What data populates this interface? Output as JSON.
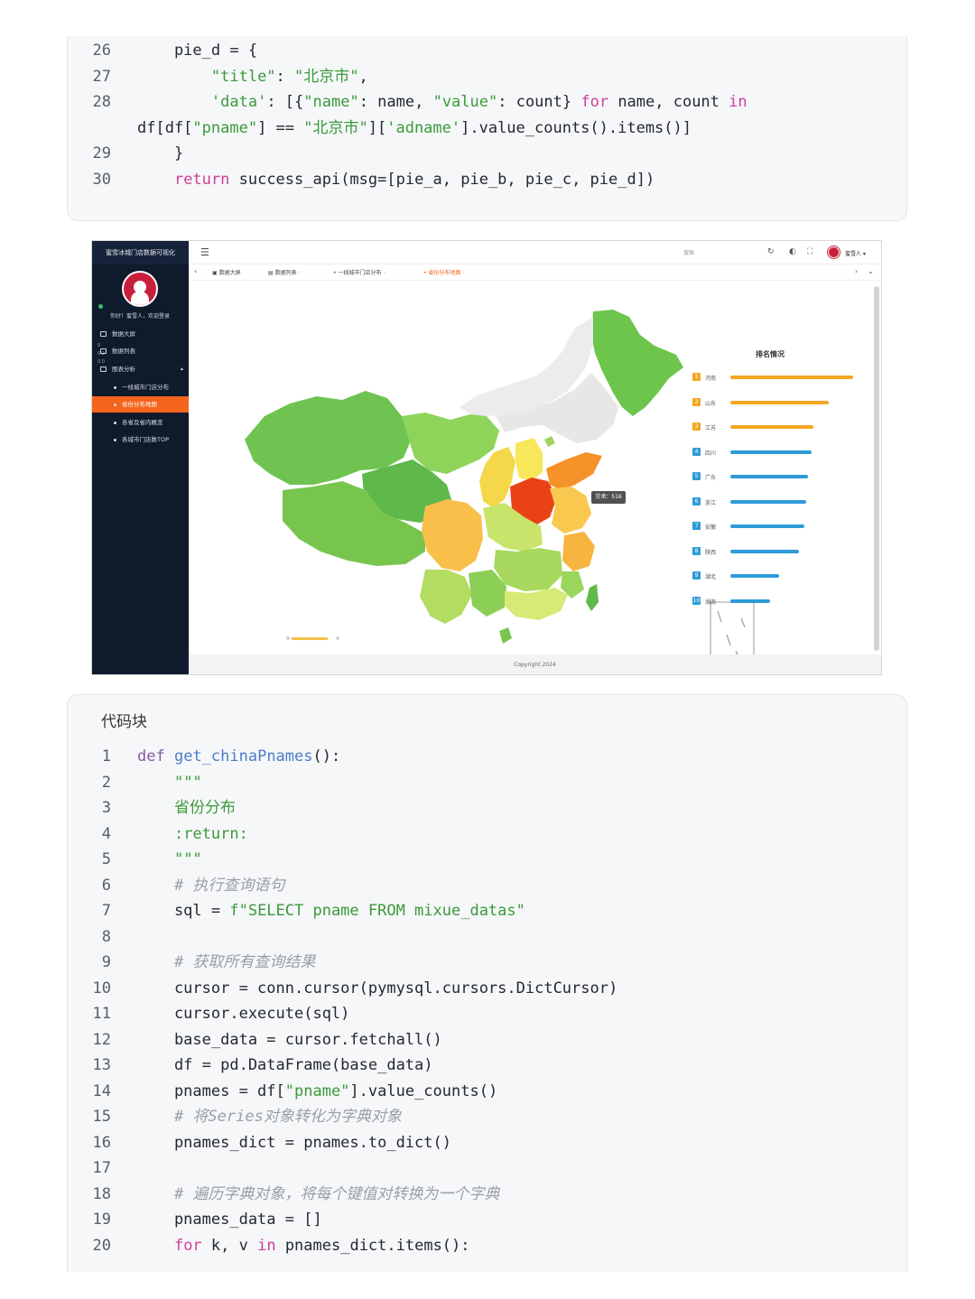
{
  "top_code": {
    "lines": [
      {
        "no": "26",
        "html": "    pie_d = {"
      },
      {
        "no": "27",
        "html": "        <span class=\"str\">\"title\"</span>: <span class=\"str\">\"北京市\"</span>,"
      },
      {
        "no": "28",
        "html": "        <span class=\"str\">'data'</span>: [{<span class=\"str\">\"name\"</span>: name, <span class=\"str\">\"value\"</span>: count} <span class=\"kw\">for</span> name, count <span class=\"kw\">in</span>"
      },
      {
        "no": "",
        "html": "df[df[<span class=\"str\">\"pname\"</span>] == <span class=\"str\">\"北京市\"</span>][<span class=\"str\">'adname'</span>].value_counts().items()]"
      },
      {
        "no": "29",
        "html": "    }"
      },
      {
        "no": "30",
        "html": "    <span class=\"kw\">return</span> success_api(msg=[pie_a, pie_b, pie_c, pie_d])"
      }
    ]
  },
  "dashboard": {
    "sidebar": {
      "app_title": "蜜雪冰城门店数据可视化",
      "greeting": "你好！蜜雪人，欢迎登录",
      "items": [
        {
          "label": "数据大屏"
        },
        {
          "label": "数据列表"
        },
        {
          "label": "图表分析"
        },
        {
          "label": "一线城市门店分布"
        },
        {
          "label": "省份分布地图"
        },
        {
          "label": "各省及省内概览"
        },
        {
          "label": "各城市门店数TOP"
        }
      ],
      "ticks": [
        "0",
        "0.2",
        "0.0"
      ]
    },
    "topbar": {
      "search_label": "搜索",
      "username": "蜜雪人 ▾"
    },
    "tabs": [
      {
        "label": "数据大屏"
      },
      {
        "label": "数据列表"
      },
      {
        "label": "一线城市门店分布"
      },
      {
        "label": "省份分布地图"
      }
    ],
    "map": {
      "tooltip": "甘肃：516",
      "ranking_title": "排名情况",
      "ranking": [
        {
          "rank": "1",
          "name": "河南",
          "value": 1.0,
          "color": "#f5a623"
        },
        {
          "rank": "2",
          "name": "山东",
          "value": 0.8,
          "color": "#f5a623"
        },
        {
          "rank": "3",
          "name": "江苏",
          "value": 0.68,
          "color": "#f5a623"
        },
        {
          "rank": "4",
          "name": "四川",
          "value": 0.66,
          "color": "#2f9bd8"
        },
        {
          "rank": "5",
          "name": "广东",
          "value": 0.63,
          "color": "#2f9bd8"
        },
        {
          "rank": "6",
          "name": "浙江",
          "value": 0.62,
          "color": "#2f9bd8"
        },
        {
          "rank": "7",
          "name": "安徽",
          "value": 0.6,
          "color": "#2f9bd8"
        },
        {
          "rank": "8",
          "name": "陕西",
          "value": 0.56,
          "color": "#2f9bd8"
        },
        {
          "rank": "9",
          "name": "湖北",
          "value": 0.4,
          "color": "#2f9bd8"
        },
        {
          "rank": "10",
          "name": "湖南",
          "value": 0.32,
          "color": "#2f9bd8"
        }
      ]
    },
    "footer": "Copyright 2024"
  },
  "bottom_code": {
    "title": "代码块",
    "lines": [
      {
        "no": "1",
        "html": "<span class=\"kw2\">def</span> <span class=\"fn\">get_chinaPnames</span>():"
      },
      {
        "no": "2",
        "html": "    <span class=\"str\">\"\"\"</span>"
      },
      {
        "no": "3",
        "html": "    <span class=\"str\">省份分布</span>"
      },
      {
        "no": "4",
        "html": "    <span class=\"str\">:return:</span>"
      },
      {
        "no": "5",
        "html": "    <span class=\"str\">\"\"\"</span>"
      },
      {
        "no": "6",
        "html": "    <span class=\"cm\"># 执行查询语句</span>"
      },
      {
        "no": "7",
        "html": "    sql = <span class=\"str\">f\"SELECT pname FROM mixue_datas\"</span>"
      },
      {
        "no": "8",
        "html": ""
      },
      {
        "no": "9",
        "html": "    <span class=\"cm\"># 获取所有查询结果</span>"
      },
      {
        "no": "10",
        "html": "    cursor = conn.cursor(pymysql.cursors.DictCursor)"
      },
      {
        "no": "11",
        "html": "    cursor.execute(sql)"
      },
      {
        "no": "12",
        "html": "    base_data = cursor.fetchall()"
      },
      {
        "no": "13",
        "html": "    df = pd.DataFrame(base_data)"
      },
      {
        "no": "14",
        "html": "    pnames = df[<span class=\"str\">\"pname\"</span>].value_counts()"
      },
      {
        "no": "15",
        "html": "    <span class=\"cm\"># 将Series对象转化为字典对象</span>"
      },
      {
        "no": "16",
        "html": "    pnames_dict = pnames.to_dict()"
      },
      {
        "no": "17",
        "html": ""
      },
      {
        "no": "18",
        "html": "    <span class=\"cm\"># 遍历字典对象，将每个键值对转换为一个字典</span>"
      },
      {
        "no": "19",
        "html": "    pnames_data = []"
      },
      {
        "no": "20",
        "html": "    <span class=\"kw\">for</span> k, v <span class=\"kw\">in</span> pnames_dict.items():"
      }
    ]
  }
}
